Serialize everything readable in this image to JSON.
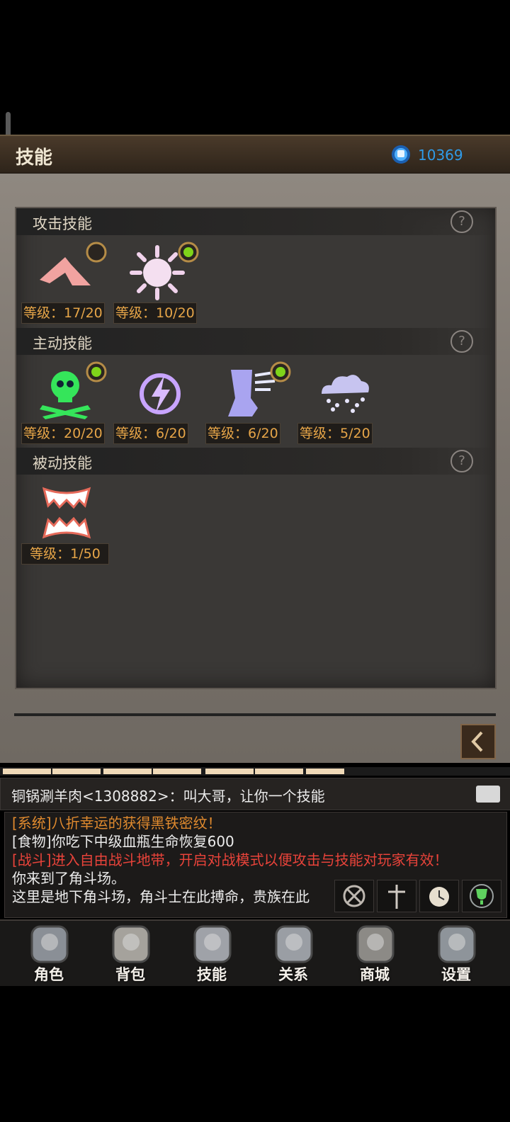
{
  "header": {
    "title": "技能",
    "currency": "10369",
    "currency_icon": "blue-gem-icon"
  },
  "sections": {
    "attack": {
      "title": "攻击技能",
      "skills": [
        {
          "icon": "slash-icon",
          "level": "等级：17/20"
        },
        {
          "icon": "sun-burst-icon",
          "level": "等级：10/20"
        }
      ]
    },
    "active": {
      "title": "主动技能",
      "skills": [
        {
          "icon": "poison-skull-icon",
          "level": "等级：20/20"
        },
        {
          "icon": "lightning-icon",
          "level": "等级：6/20"
        },
        {
          "icon": "wind-boot-icon",
          "level": "等级：6/20"
        },
        {
          "icon": "storm-cloud-icon",
          "level": "等级：5/20"
        }
      ]
    },
    "passive": {
      "title": "被动技能",
      "skills": [
        {
          "icon": "fangs-icon",
          "level": "等级：1/50"
        }
      ]
    }
  },
  "chat": {
    "message": "铜锅涮羊肉<1308882>：叫大哥，让你一个技能",
    "log": [
      {
        "text": "[系统]八折幸运的获得黑铁密纹！",
        "color": "#e08a2e"
      },
      {
        "text": "[食物]你吃下中级血瓶生命恢复600",
        "color": "#ececec"
      },
      {
        "text": "[战斗]进入自由战斗地带，开启对战模式以便攻击与技能对玩家有效！",
        "color": "#e8433a"
      },
      {
        "text": "你来到了角斗场。",
        "color": "#ececec"
      },
      {
        "text": "这里是地下角斗场，角斗士在此搏命，贵族在此",
        "color": "#ececec"
      }
    ]
  },
  "nav": [
    {
      "label": "角色",
      "icon": "helmet-icon"
    },
    {
      "label": "背包",
      "icon": "backpack-icon"
    },
    {
      "label": "技能",
      "icon": "skill-book-icon"
    },
    {
      "label": "关系",
      "icon": "handshake-icon"
    },
    {
      "label": "商城",
      "icon": "treasure-chest-icon"
    },
    {
      "label": "设置",
      "icon": "settings-gear-icon"
    }
  ],
  "colors": {
    "level_text": "#e6a548",
    "currency_text": "#2f9be8",
    "active_dot": "#7fd41a"
  }
}
